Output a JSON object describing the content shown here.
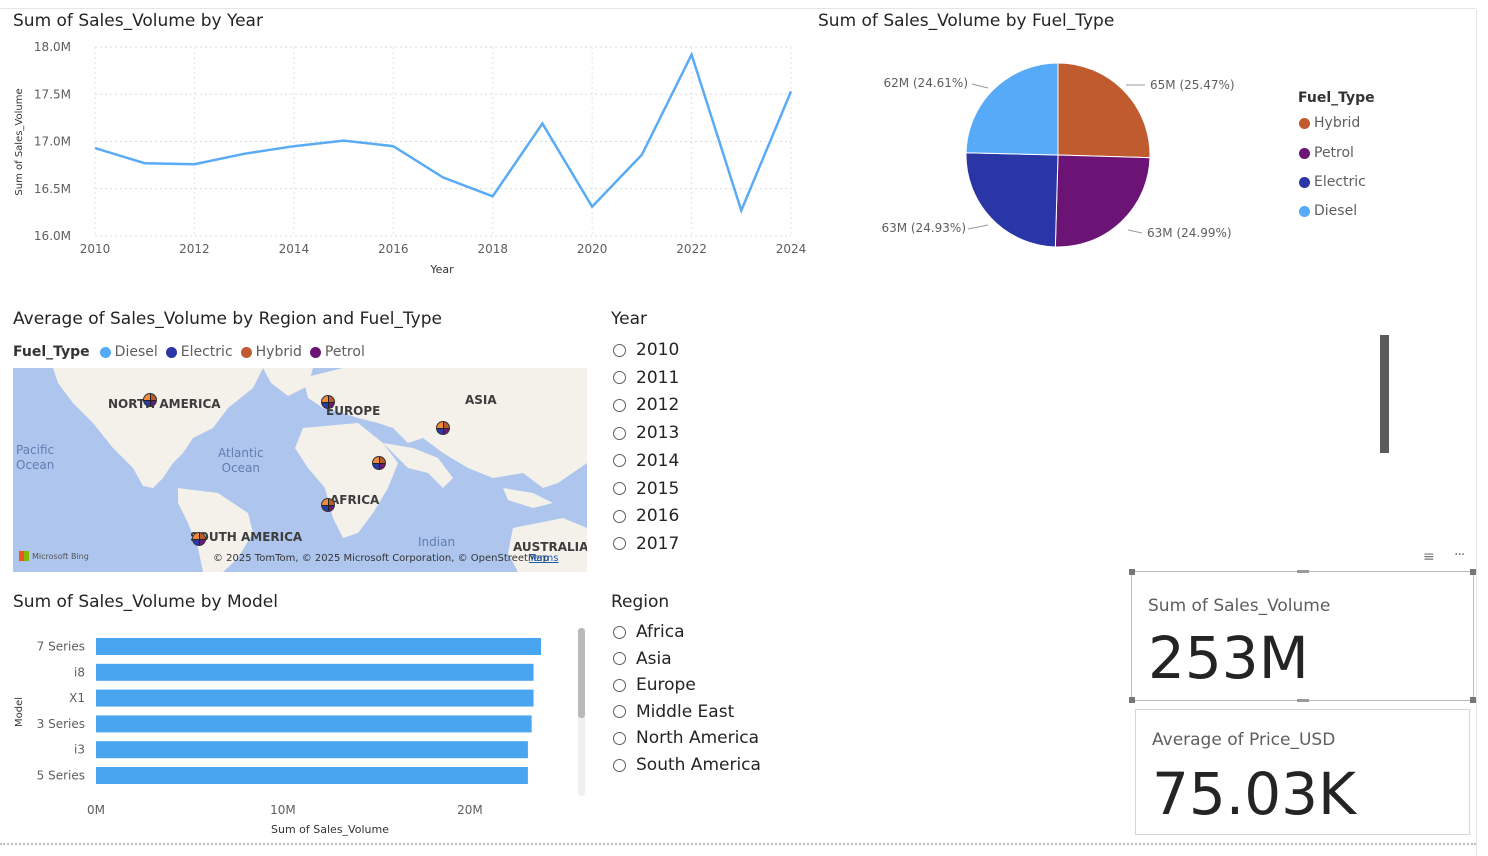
{
  "line_chart": {
    "title": "Sum of Sales_Volume by Year",
    "xlabel": "Year",
    "ylabel": "Sum of Sales_Volume"
  },
  "pie_chart": {
    "title": "Sum of Sales_Volume by Fuel_Type",
    "legend_title": "Fuel_Type",
    "legend": [
      "Hybrid",
      "Petrol",
      "Electric",
      "Diesel"
    ],
    "slice_labels": [
      "65M (25.47%)",
      "63M (24.99%)",
      "63M (24.93%)",
      "62M (24.61%)"
    ]
  },
  "map_visual": {
    "title": "Average of Sales_Volume by Region and Fuel_Type",
    "legend_title": "Fuel_Type",
    "legend": [
      "Diesel",
      "Electric",
      "Hybrid",
      "Petrol"
    ],
    "continents": [
      "NORTH AMERICA",
      "EUROPE",
      "ASIA",
      "AFRICA",
      "SOUTH AMERICA",
      "AUSTRALIA"
    ],
    "oceans": [
      "Pacific\nOcean",
      "Atlantic\nOcean",
      "Indian"
    ],
    "provider": "Microsoft Bing",
    "attribution": "© 2025 TomTom, © 2025 Microsoft Corporation, © OpenStreetMap",
    "terms": "Terms"
  },
  "bar_chart": {
    "title": "Sum of Sales_Volume by Model",
    "xlabel": "Sum of Sales_Volume",
    "ylabel": "Model"
  },
  "year_slicer": {
    "title": "Year",
    "items": [
      "2010",
      "2011",
      "2012",
      "2013",
      "2014",
      "2015",
      "2016",
      "2017"
    ]
  },
  "region_slicer": {
    "title": "Region",
    "items": [
      "Africa",
      "Asia",
      "Europe",
      "Middle East",
      "North America",
      "South America"
    ]
  },
  "card_sales": {
    "label": "Sum of Sales_Volume",
    "value": "253M"
  },
  "card_price": {
    "label": "Average of Price_USD",
    "value": "75.03K"
  },
  "colors": {
    "line": "#5aabf5",
    "bar": "#4aa5f0",
    "hybrid": "#c05a2f",
    "petrol": "#6b1475",
    "electric": "#2a36a6",
    "diesel": "#56aaf7"
  },
  "chart_data": [
    {
      "type": "line",
      "title": "Sum of Sales_Volume by Year",
      "xlabel": "Year",
      "ylabel": "Sum of Sales_Volume",
      "x": [
        2010,
        2011,
        2012,
        2013,
        2014,
        2015,
        2016,
        2017,
        2018,
        2019,
        2020,
        2021,
        2022,
        2023,
        2024
      ],
      "series": [
        {
          "values": [
            16.93,
            16.77,
            16.76,
            16.87,
            16.95,
            17.01,
            16.95,
            16.62,
            16.42,
            17.19,
            16.31,
            16.86,
            17.92,
            16.27,
            17.53
          ]
        }
      ],
      "x_ticks": [
        "2010",
        "2012",
        "2014",
        "2016",
        "2018",
        "2020",
        "2022",
        "2024"
      ],
      "y_ticks": [
        "16.0M",
        "16.5M",
        "17.0M",
        "17.5M",
        "18.0M"
      ],
      "ylim": [
        16.0,
        18.0
      ],
      "unit": "M",
      "grid": true
    },
    {
      "type": "pie",
      "title": "Sum of Sales_Volume by Fuel_Type",
      "categories": [
        "Hybrid",
        "Petrol",
        "Electric",
        "Diesel"
      ],
      "values": [
        25.47,
        24.99,
        24.93,
        24.61
      ],
      "legend": "right"
    },
    {
      "type": "bar",
      "orientation": "horizontal",
      "title": "Sum of Sales_Volume by Model",
      "xlabel": "Sum of Sales_Volume",
      "ylabel": "Model",
      "categories": [
        "7 Series",
        "i8",
        "X1",
        "3 Series",
        "i3",
        "5 Series"
      ],
      "values": [
        23.8,
        23.4,
        23.4,
        23.3,
        23.1,
        23.1
      ],
      "x_ticks": [
        "0M",
        "10M",
        "20M"
      ],
      "xlim": [
        0,
        23.8
      ],
      "unit": "M"
    }
  ]
}
